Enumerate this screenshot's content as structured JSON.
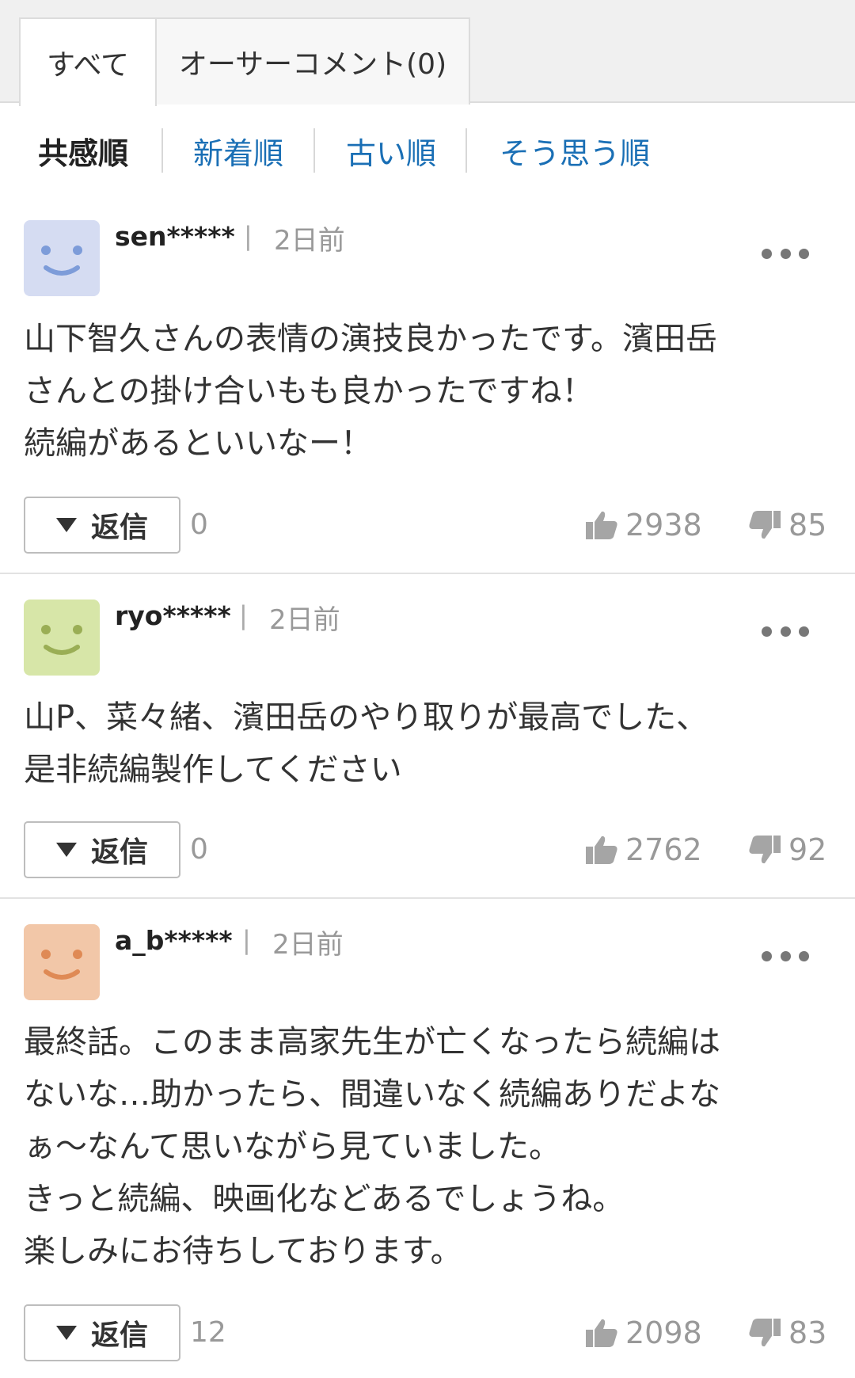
{
  "tabs": {
    "all": "すべて",
    "owner": "オーサーコメント(0)"
  },
  "sort": [
    {
      "label": "共感順",
      "active": true
    },
    {
      "label": "新着順",
      "active": false
    },
    {
      "label": "古い順",
      "active": false
    },
    {
      "label": "そう思う順",
      "active": false
    }
  ],
  "comments": [
    {
      "user": "sen*****",
      "time": "2日前",
      "avatar_color": "#d5dcf2",
      "avatar_feature_color": "#7d9cd9",
      "text": "山下智久さんの表情の演技良かったです。濱田岳\nさんとの掛け合いもも良かったですね！\n続編があるといいなー！",
      "reply_label": "返信",
      "reply_count": "0",
      "likes": "2938",
      "dislikes": "85"
    },
    {
      "user": "ryo*****",
      "time": "2日前",
      "avatar_color": "#d7e6a8",
      "avatar_feature_color": "#9aae55",
      "text": "山P、菜々緒、濱田岳のやり取りが最高でした、\n是非続編製作してください",
      "reply_label": "返信",
      "reply_count": "0",
      "likes": "2762",
      "dislikes": "92"
    },
    {
      "user": "a_b*****",
      "time": "2日前",
      "avatar_color": "#f2c7a8",
      "avatar_feature_color": "#df8a55",
      "text": "最終話。このまま高家先生が亡くなったら続編は\nないな…助かったら、間違いなく続編ありだよな\nぁ〜なんて思いながら見ていました。\nきっと続編、映画化などあるでしょうね。\n楽しみにお待ちしております。",
      "reply_label": "返信",
      "reply_count": "12",
      "likes": "2098",
      "dislikes": "83"
    }
  ],
  "icons": {
    "more": "more-dots-icon",
    "like": "thumbs-up-icon",
    "dislike": "thumbs-down-icon",
    "reply_toggle": "triangle-down-icon",
    "avatar": "smiley-face-icon"
  }
}
